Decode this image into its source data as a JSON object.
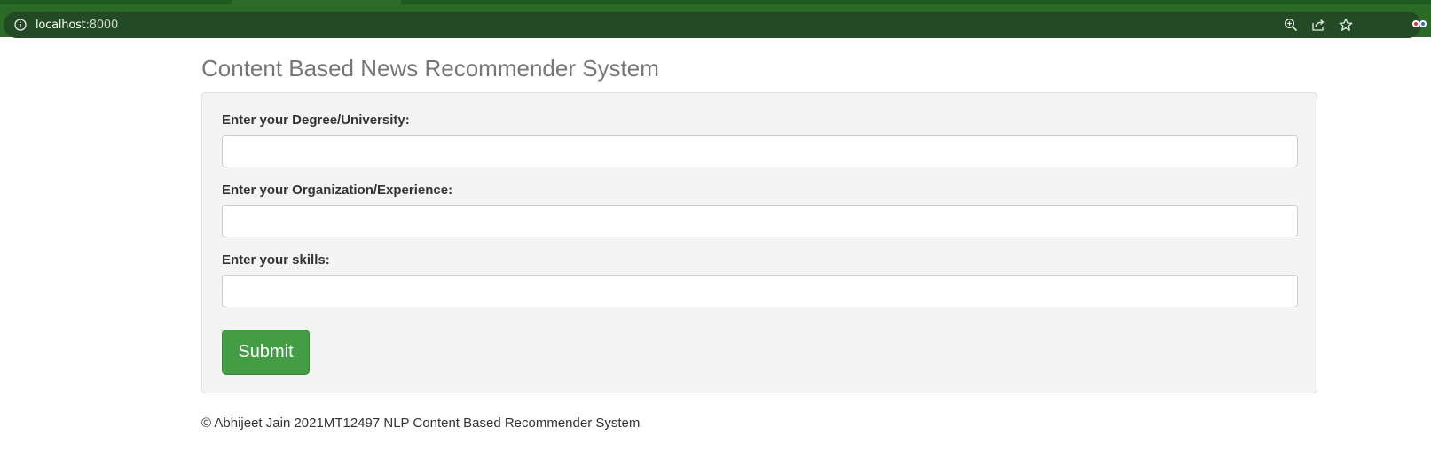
{
  "browser": {
    "url_host": "localhost",
    "url_port": ":8000"
  },
  "page": {
    "title": "Content Based News Recommender System",
    "form": {
      "degree_label": "Enter your Degree/University:",
      "degree_value": "",
      "organization_label": "Enter your Organization/Experience:",
      "organization_value": "",
      "skills_label": "Enter your skills:",
      "skills_value": "",
      "submit_label": "Submit"
    },
    "footer": "© Abhijeet Jain 2021MT12497 NLP Content Based Recommender System"
  },
  "colors": {
    "chrome": "#2c6a28",
    "submit": "#449d44",
    "title": "#777777"
  }
}
